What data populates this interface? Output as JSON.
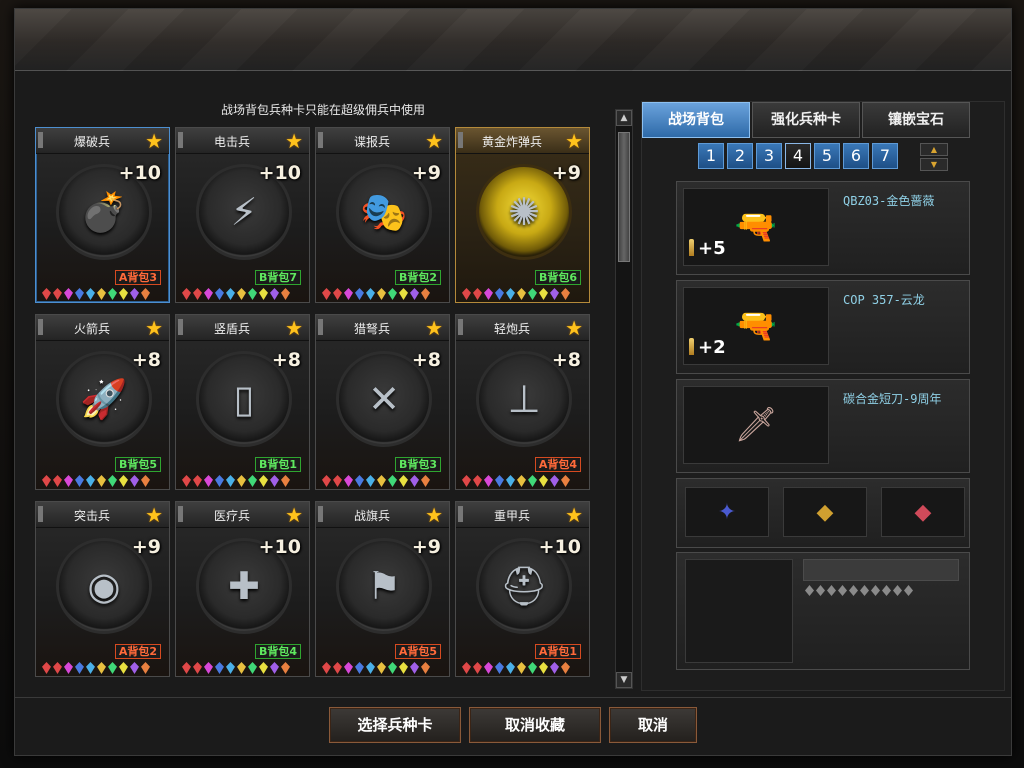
{
  "notice": "战场背包兵种卡只能在超级佣兵中使用",
  "cards": [
    {
      "name": "爆破兵",
      "plus": "+10",
      "pack": "A背包3",
      "pack_type": "A",
      "icon": "bomb-pack-icon",
      "glyph": "💣",
      "selected": true,
      "gold": false
    },
    {
      "name": "电击兵",
      "plus": "+10",
      "pack": "B背包7",
      "pack_type": "B",
      "icon": "shock-glove-icon",
      "glyph": "⚡",
      "selected": false,
      "gold": false
    },
    {
      "name": "谍报兵",
      "plus": "+9",
      "pack": "B背包2",
      "pack_type": "B",
      "icon": "spy-mask-icon",
      "glyph": "🎭",
      "selected": false,
      "gold": false
    },
    {
      "name": "黄金炸弹兵",
      "plus": "+9",
      "pack": "B背包6",
      "pack_type": "B",
      "icon": "gold-bomb-icon",
      "glyph": "✺",
      "selected": false,
      "gold": true
    },
    {
      "name": "火箭兵",
      "plus": "+8",
      "pack": "B背包5",
      "pack_type": "B",
      "icon": "rocket-launcher-icon",
      "glyph": "🚀",
      "selected": false,
      "gold": false
    },
    {
      "name": "竖盾兵",
      "plus": "+8",
      "pack": "B背包1",
      "pack_type": "B",
      "icon": "shield-icon",
      "glyph": "▯",
      "selected": false,
      "gold": false
    },
    {
      "name": "猎弩兵",
      "plus": "+8",
      "pack": "B背包3",
      "pack_type": "B",
      "icon": "crossbow-icon",
      "glyph": "✕",
      "selected": false,
      "gold": false
    },
    {
      "name": "轻炮兵",
      "plus": "+8",
      "pack": "A背包4",
      "pack_type": "A",
      "icon": "mortar-icon",
      "glyph": "⊥",
      "selected": false,
      "gold": false
    },
    {
      "name": "突击兵",
      "plus": "+9",
      "pack": "A背包2",
      "pack_type": "A",
      "icon": "scope-icon",
      "glyph": "◉",
      "selected": false,
      "gold": false
    },
    {
      "name": "医疗兵",
      "plus": "+10",
      "pack": "B背包4",
      "pack_type": "B",
      "icon": "medkit-icon",
      "glyph": "✚",
      "selected": false,
      "gold": false
    },
    {
      "name": "战旗兵",
      "plus": "+9",
      "pack": "A背包5",
      "pack_type": "A",
      "icon": "banner-icon",
      "glyph": "⚑",
      "selected": false,
      "gold": false
    },
    {
      "name": "重甲兵",
      "plus": "+10",
      "pack": "A背包1",
      "pack_type": "A",
      "icon": "helmet-icon",
      "glyph": "⛑",
      "selected": false,
      "gold": false
    }
  ],
  "gem_colors": [
    "#e04848",
    "#e04848",
    "#d848d8",
    "#4a7ae0",
    "#4ab0e8",
    "#e8c040",
    "#40d878",
    "#e8e040",
    "#a060e8",
    "#e88040"
  ],
  "tabs": [
    "战场背包",
    "强化兵种卡",
    "镶嵌宝石"
  ],
  "pages": [
    "1",
    "2",
    "3",
    "4",
    "5",
    "6",
    "7"
  ],
  "active_page": 3,
  "weapons": [
    {
      "name": "QBZ03-金色蔷薇",
      "plus": "+5",
      "icon": "rifle-icon",
      "glyph": "🔫"
    },
    {
      "name": "COP 357-云龙",
      "plus": "+2",
      "icon": "pistol-icon",
      "glyph": "🔫"
    },
    {
      "name": "碳合金短刀-9周年",
      "plus": "",
      "icon": "knife-icon",
      "glyph": "🗡"
    }
  ],
  "grenades": [
    {
      "icon": "grenade-blue-icon",
      "glyph": "✦",
      "color": "#4a5ad0"
    },
    {
      "icon": "grenade-gold-icon",
      "glyph": "◆",
      "color": "#d0a030"
    },
    {
      "icon": "grenade-red-icon",
      "glyph": "◆",
      "color": "#d04a5a"
    }
  ],
  "buttons": [
    "选择兵种卡",
    "取消收藏",
    "取消"
  ]
}
